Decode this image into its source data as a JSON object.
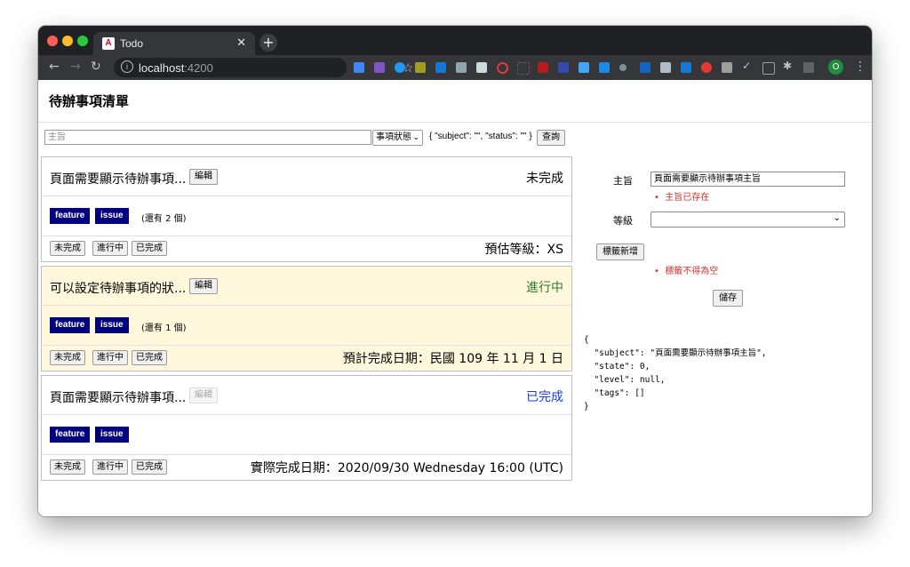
{
  "browser": {
    "tab_title": "Todo",
    "tab_icon": "A",
    "url_host": "localhost",
    "url_port": ":4200",
    "profile_initial": "O"
  },
  "app": {
    "title": "待辦事項清單"
  },
  "search": {
    "placeholder": "主旨",
    "status_select": "事項狀態",
    "query_json": "{ \"subject\": \"\", \"status\": \"\" }",
    "query_button": "查詢"
  },
  "todos": [
    {
      "title": "頁面需要顯示待辦事項...",
      "edit_label": "編輯",
      "status": "未完成",
      "status_color": "#000000",
      "tags": [
        "feature",
        "issue"
      ],
      "more": "(還有 2 個)",
      "buttons": [
        "未完成",
        "進行中",
        "已完成"
      ],
      "info": "預估等級：XS"
    },
    {
      "title": "可以設定待辦事項的狀...",
      "edit_label": "編輯",
      "status": "進行中",
      "status_color": "#2e7d32",
      "tags": [
        "feature",
        "issue"
      ],
      "more": "(還有 1 個)",
      "buttons": [
        "未完成",
        "進行中",
        "已完成"
      ],
      "info": "預計完成日期：民國 109 年 11 月 1 日"
    },
    {
      "title": "頁面需要顯示待辦事項...",
      "edit_label": "編輯",
      "status": "已完成",
      "status_color": "#1a3fd6",
      "tags": [
        "feature",
        "issue"
      ],
      "more": "",
      "buttons": [
        "未完成",
        "進行中",
        "已完成"
      ],
      "info": "實際完成日期：2020/09/30 Wednesday 16:00 (UTC)"
    }
  ],
  "form": {
    "subject_label": "主旨",
    "subject_value": "頁面需要顯示待辦事項主旨",
    "subject_error": "主旨已存在",
    "level_label": "等級",
    "level_value": "",
    "add_tag_button": "標籤新增",
    "tag_error": "標籤不得為空",
    "save_button": "儲存"
  },
  "json_preview": "{\n  \"subject\": \"頁面需要顯示待辦事項主旨\",\n  \"state\": 0,\n  \"level\": null,\n  \"tags\": []\n}",
  "colors": {
    "tag_bg": "#000080",
    "error": "#d32f2f",
    "inprogress_bg": "#fff8dc"
  }
}
